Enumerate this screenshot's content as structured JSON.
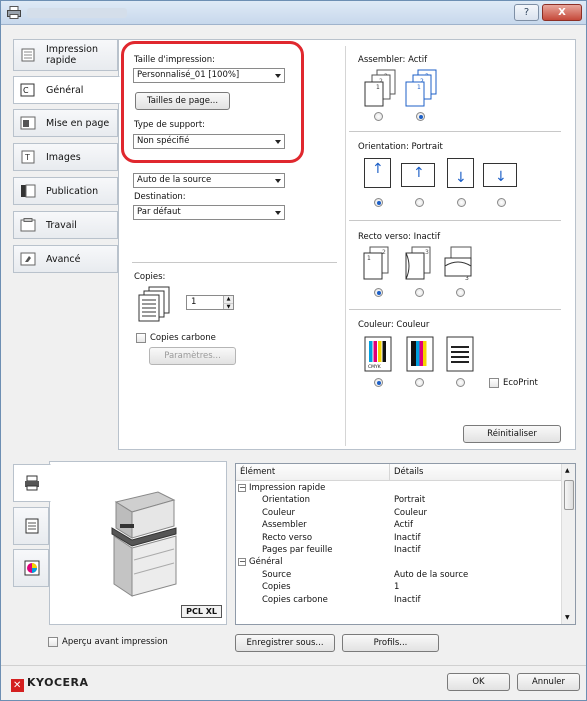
{
  "window": {
    "help_label": "?",
    "close_label": "X"
  },
  "tabs": [
    {
      "label": "Impression rapide",
      "icon": "quick-print-icon",
      "active": false
    },
    {
      "label": "Général",
      "icon": "general-icon",
      "active": true
    },
    {
      "label": "Mise en page",
      "icon": "layout-icon",
      "active": false
    },
    {
      "label": "Images",
      "icon": "images-icon",
      "active": false
    },
    {
      "label": "Publication",
      "icon": "publication-icon",
      "active": false
    },
    {
      "label": "Travail",
      "icon": "job-icon",
      "active": false
    },
    {
      "label": "Avancé",
      "icon": "advanced-icon",
      "active": false
    }
  ],
  "general": {
    "print_size_label": "Taille d'impression:",
    "print_size_value": "Personnalisé_01 [100%]",
    "page_sizes_button": "Tailles de page...",
    "media_type_label": "Type de support:",
    "media_type_value": "Non spécifié",
    "source_value": "Auto de la source",
    "destination_label": "Destination:",
    "destination_value": "Par défaut",
    "copies_label": "Copies:",
    "copies_value": "1",
    "carbon_copies_label": "Copies carbone",
    "parameters_button": "Paramètres...",
    "collate_label": "Assembler: Actif",
    "orientation_label": "Orientation: Portrait",
    "duplex_label": "Recto verso: Inactif",
    "color_label": "Couleur: Couleur",
    "ecoprint_label": "EcoPrint",
    "reset_button": "Réinitialiser"
  },
  "preview": {
    "pcl_label": "PCL XL",
    "preview_checkbox_label": "Aperçu avant impression"
  },
  "summary_table": {
    "col_item": "Élément",
    "col_details": "Détails",
    "rows": [
      {
        "item": "Impression rapide",
        "detail": "",
        "group": true
      },
      {
        "item": "Orientation",
        "detail": "Portrait",
        "group": false
      },
      {
        "item": "Couleur",
        "detail": "Couleur",
        "group": false
      },
      {
        "item": "Assembler",
        "detail": "Actif",
        "group": false
      },
      {
        "item": "Recto verso",
        "detail": "Inactif",
        "group": false
      },
      {
        "item": "Pages par feuille",
        "detail": "Inactif",
        "group": false
      },
      {
        "item": "Général",
        "detail": "",
        "group": true
      },
      {
        "item": "Source",
        "detail": "Auto de la source",
        "group": false
      },
      {
        "item": "Copies",
        "detail": "1",
        "group": false
      },
      {
        "item": "Copies carbone",
        "detail": "Inactif",
        "group": false
      }
    ]
  },
  "footer": {
    "save_as_button": "Enregistrer sous...",
    "profiles_button": "Profils...",
    "logo_text": "KYOCERA",
    "ok_button": "OK",
    "cancel_button": "Annuler"
  },
  "colors": {
    "highlight": "#e0282e",
    "selected_radio": "#1c5fc7",
    "logo": "#d42020"
  }
}
